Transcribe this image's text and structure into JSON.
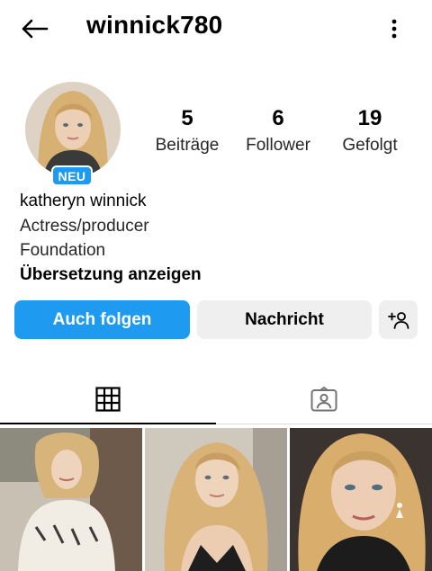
{
  "header": {
    "username": "winnick780",
    "back_icon": "arrow-left-icon",
    "more_icon": "more-vertical-icon"
  },
  "profile": {
    "avatar_badge": "NEU",
    "stats": [
      {
        "value": "5",
        "label": "Beiträge"
      },
      {
        "value": "6",
        "label": "Follower"
      },
      {
        "value": "19",
        "label": "Gefolgt"
      }
    ],
    "bio": {
      "name": "katheryn winnick",
      "title": "Actress/producer",
      "category": "Foundation",
      "translate": "Übersetzung anzeigen"
    }
  },
  "actions": {
    "follow_label": "Auch folgen",
    "message_label": "Nachricht",
    "add_user_icon": "add-person-icon"
  },
  "tabs": [
    {
      "name": "posts",
      "icon": "grid-icon",
      "active": true
    },
    {
      "name": "tagged",
      "icon": "tagged-person-icon",
      "active": false
    }
  ],
  "colors": {
    "accent": "#1e9bf0",
    "secondary_button": "#efefef",
    "divider": "#dbdbdb"
  }
}
